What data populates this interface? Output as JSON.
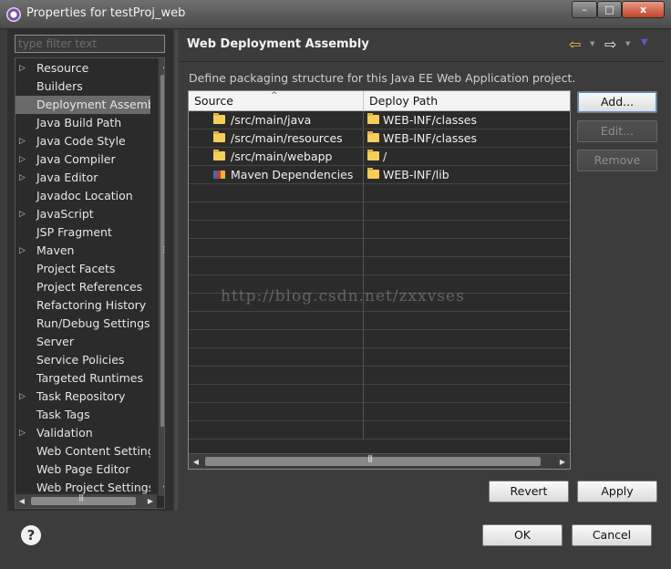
{
  "window": {
    "title": "Properties for testProj_web",
    "min_glyph": "–",
    "max_glyph": "□",
    "close_glyph": "x"
  },
  "filter": {
    "placeholder": "type filter text"
  },
  "tree": {
    "items": [
      {
        "label": "Resource",
        "expandable": true
      },
      {
        "label": "Builders",
        "expandable": false
      },
      {
        "label": "Deployment Assembly",
        "expandable": false,
        "selected": true
      },
      {
        "label": "Java Build Path",
        "expandable": false
      },
      {
        "label": "Java Code Style",
        "expandable": true
      },
      {
        "label": "Java Compiler",
        "expandable": true
      },
      {
        "label": "Java Editor",
        "expandable": true
      },
      {
        "label": "Javadoc Location",
        "expandable": false
      },
      {
        "label": "JavaScript",
        "expandable": true
      },
      {
        "label": "JSP Fragment",
        "expandable": false
      },
      {
        "label": "Maven",
        "expandable": true
      },
      {
        "label": "Project Facets",
        "expandable": false
      },
      {
        "label": "Project References",
        "expandable": false
      },
      {
        "label": "Refactoring History",
        "expandable": false
      },
      {
        "label": "Run/Debug Settings",
        "expandable": false
      },
      {
        "label": "Server",
        "expandable": false
      },
      {
        "label": "Service Policies",
        "expandable": false
      },
      {
        "label": "Targeted Runtimes",
        "expandable": false
      },
      {
        "label": "Task Repository",
        "expandable": true
      },
      {
        "label": "Task Tags",
        "expandable": false
      },
      {
        "label": "Validation",
        "expandable": true
      },
      {
        "label": "Web Content Settings",
        "expandable": false
      },
      {
        "label": "Web Page Editor",
        "expandable": false
      },
      {
        "label": "Web Project Settings",
        "expandable": false
      }
    ]
  },
  "page": {
    "title": "Web Deployment Assembly",
    "description": "Define packaging structure for this Java EE Web Application project.",
    "nav_back_glyph": "⇦",
    "nav_forward_glyph": "⇨",
    "dropdown_glyph": "▼"
  },
  "table": {
    "columns": [
      "Source",
      "Deploy Path"
    ],
    "rows": [
      {
        "source": "/src/main/java",
        "deploy": "WEB-INF/classes",
        "icon": "folder-icon"
      },
      {
        "source": "/src/main/resources",
        "deploy": "WEB-INF/classes",
        "icon": "folder-icon"
      },
      {
        "source": "/src/main/webapp",
        "deploy": "/",
        "icon": "folder-icon"
      },
      {
        "source": "Maven Dependencies",
        "deploy": "WEB-INF/lib",
        "icon": "library-icon"
      }
    ],
    "empty_rows": 14
  },
  "watermark": "http://blog.csdn.net/zxxvses",
  "buttons": {
    "add": "Add...",
    "edit": "Edit...",
    "remove": "Remove",
    "revert": "Revert",
    "apply": "Apply",
    "ok": "OK",
    "cancel": "Cancel"
  },
  "help_glyph": "?",
  "colors": {
    "background": "#3c3c3c",
    "tree_selection": "#6a6a6a",
    "back_arrow": "#e8c540",
    "folder": "#f3cf5a"
  }
}
